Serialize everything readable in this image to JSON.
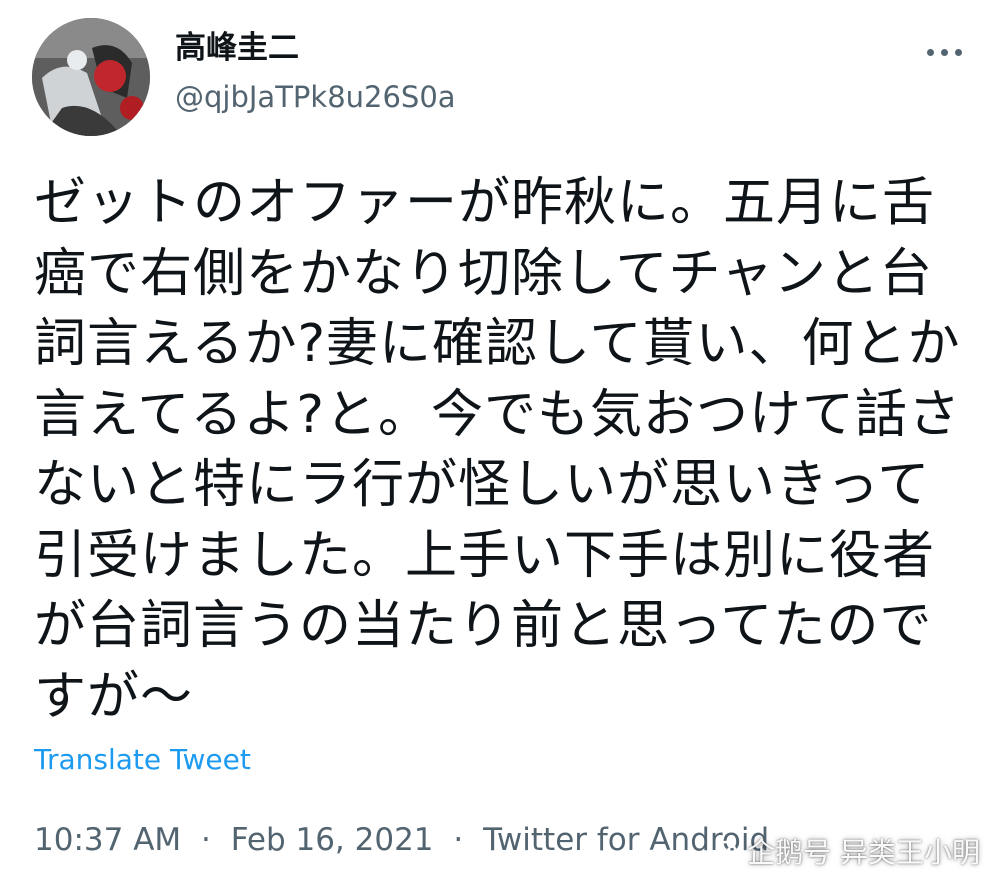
{
  "author": {
    "display_name": "高峰圭二",
    "handle": "@qjbJaTPk8u26S0a"
  },
  "tweet": {
    "text": "ゼットのオファーが昨秋に。五月に舌癌で右側をかなり切除してチャンと台詞言えるか?妻に確認して貰い、何とか言えてるよ?と。今でも気おつけて話さないと特にラ行が怪しいが思いきって引受けました。上手い下手は別に役者が台詞言うの当たり前と思ってたのですが〜",
    "translate_label": "Translate Tweet",
    "time": "10:37 AM",
    "date": "Feb 16, 2021",
    "source": "Twitter for Android",
    "separator": "·"
  },
  "icons": {
    "more": "more-horizontal-icon",
    "watermark": "penguin-logo-icon"
  },
  "watermark": {
    "text": "企鹅号 异类王小明"
  },
  "colors": {
    "text_primary": "#0f1419",
    "text_secondary": "#536471",
    "link": "#1d9bf0",
    "background": "#ffffff"
  }
}
